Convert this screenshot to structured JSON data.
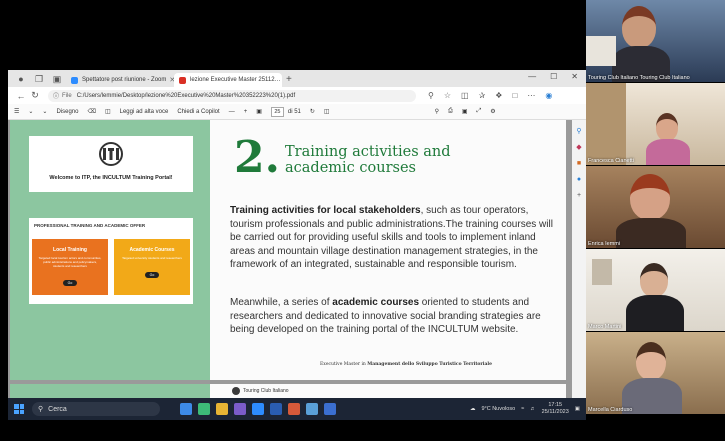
{
  "browser": {
    "tabs": [
      {
        "label": "Spettatore post riunione - Zoom",
        "color": "#2d8cff",
        "active": false
      },
      {
        "label": "lezione Executive Master 25112…",
        "color": "#d93025",
        "active": true
      }
    ],
    "file_label": "File",
    "url": "C:/Users/lemmie/Desktop/lezione%20Executive%20Master%20352223%20(1).pdf",
    "tab_new": "+",
    "window_controls": {
      "minimize": "—",
      "maximize": "☐",
      "close": "✕"
    }
  },
  "pdf_toolbar": {
    "draw": "Disegno",
    "read_aloud": "Leggi ad alta voce",
    "ask_copilot": "Chiedi a Copilot",
    "zoom_minus": "—",
    "zoom_plus": "+",
    "page_current": "25",
    "page_of": "di 51"
  },
  "slide": {
    "welcome": "Welcome to ITP, the INCULTUM Training Portal!",
    "logo_text": "ITP",
    "offer_title": "PROFESSIONAL TRAINING AND ACADEMIC OFFER",
    "local_training": "Local Training",
    "local_training_sub": "Targeted local tourism actors and communities, public administrations and policymakers, students and researchers",
    "academic_courses": "Academic Courses",
    "academic_courses_sub": "Targeted university students and researchers",
    "go_label": "Go",
    "number": "2.",
    "title_line1": "Training activities and",
    "title_line2": "academic courses",
    "p1_bold": "Training activities for local stakeholders",
    "p1_rest": ", such as tour operators, tourism professionals and public administrations.The training courses will be carried out for providing useful skills and tools to implement inland areas and mountain village destination management strategies, in the framework of an integrated, sustainable and responsible tourism.",
    "p2_start": "Meanwhile, a series of ",
    "p2_bold": "academic courses",
    "p2_rest": " oriented to students and researchers and dedicated to innovative social branding strategies are being developed on the training portal of the INCULTUM website.",
    "footer_pre": "Executive Master in ",
    "footer_bold": "Management dello Sviluppo Turistico Territoriale",
    "next_page_brand": "Touring Club Italiano"
  },
  "taskbar": {
    "search_placeholder": "Cerca",
    "weather": "9°C Nuvoloso",
    "time": "17:15",
    "date": "25/11/2023"
  },
  "participants": [
    {
      "name": "Touring Club Italiano Touring Club Italiano",
      "bg": "#2b3b55"
    },
    {
      "name": "Francesca Cianetti",
      "bg": "#d9cbb8"
    },
    {
      "name": "Enrica Iemmi",
      "bg": "#8a6a4a"
    },
    {
      "name": "Marco Martini",
      "bg": "#e7e3da"
    },
    {
      "name": "Marcella Ciarduso",
      "bg": "#a88e6c"
    }
  ]
}
